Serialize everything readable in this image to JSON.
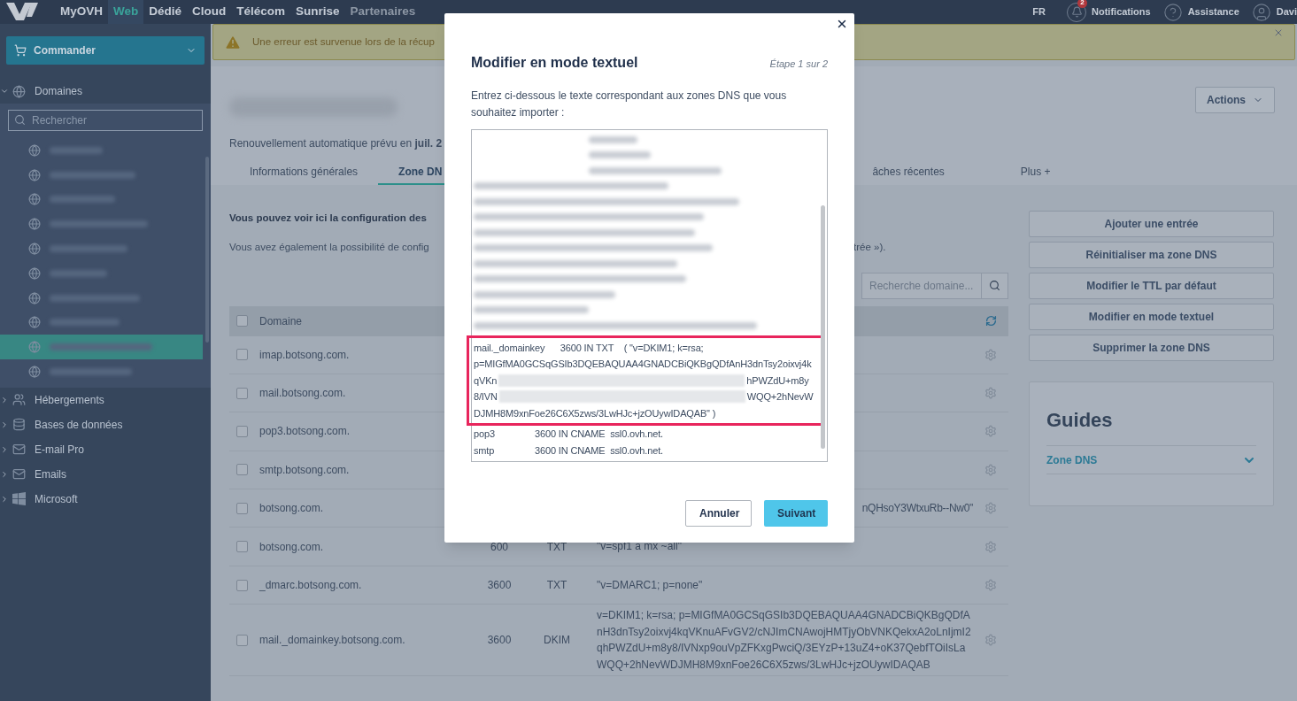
{
  "top_nav": {
    "items": [
      {
        "label": "MyOVH",
        "selected": false,
        "disabled": false
      },
      {
        "label": "Web",
        "selected": true,
        "disabled": false
      },
      {
        "label": "Dédié",
        "selected": false,
        "disabled": false
      },
      {
        "label": "Cloud",
        "selected": false,
        "disabled": false
      },
      {
        "label": "Télécom",
        "selected": false,
        "disabled": false
      },
      {
        "label": "Sunrise",
        "selected": false,
        "disabled": false
      },
      {
        "label": "Partenaires",
        "selected": false,
        "disabled": true
      }
    ],
    "language": "FR",
    "notifications": {
      "label": "Notifications",
      "badge": "2"
    },
    "assistance": "Assistance",
    "user": "Davi"
  },
  "sidebar": {
    "order_button": "Commander",
    "search_placeholder": "Rechercher",
    "sections": [
      {
        "label": "Domaines",
        "expanded": true
      },
      {
        "label": "Hébergements",
        "expanded": false
      },
      {
        "label": "Bases de données",
        "expanded": false
      },
      {
        "label": "E-mail Pro",
        "expanded": false
      },
      {
        "label": "Emails",
        "expanded": false
      },
      {
        "label": "Microsoft",
        "expanded": false
      }
    ],
    "domain_items": [
      {
        "selected": false
      },
      {
        "selected": false
      },
      {
        "selected": false
      },
      {
        "selected": false
      },
      {
        "selected": false
      },
      {
        "selected": false
      },
      {
        "selected": false
      },
      {
        "selected": false
      },
      {
        "selected": true
      },
      {
        "selected": false
      }
    ]
  },
  "alert": {
    "message": "Une erreur est survenue lors de la récup"
  },
  "header": {
    "actions_button": "Actions",
    "renewal": "Renouvellement automatique prévu en **juil. 2**",
    "tabs": [
      {
        "label": "Informations générales",
        "selected": false
      },
      {
        "label": "Zone DN",
        "selected": true
      },
      {
        "label": "âches récentes",
        "selected": false
      },
      {
        "label": "Plus +",
        "selected": false
      }
    ]
  },
  "zone": {
    "intro_bold": "Vous pouvez voir ici la configuration des",
    "intro": "Vous avez également la possibilité de config",
    "intro_end": "trée »).",
    "search_placeholder": "Recherche domaine...",
    "table": {
      "columns": [
        "Domaine"
      ],
      "header_checked": false,
      "rows": [
        {
          "domain": "imap.botsong.com.",
          "checked": false
        },
        {
          "domain": "mail.botsong.com.",
          "checked": false
        },
        {
          "domain": "pop3.botsong.com.",
          "checked": false
        },
        {
          "domain": "smtp.botsong.com.",
          "checked": false
        },
        {
          "domain": "botsong.com.",
          "target": "nQHsoY3WtxuRb--Nw0\"",
          "checked": false
        },
        {
          "domain": "botsong.com.",
          "ttl": "600",
          "type": "TXT",
          "target": "\"v=spf1 a mx ~all\"",
          "checked": false
        },
        {
          "domain": "_dmarc.botsong.com.",
          "ttl": "3600",
          "type": "TXT",
          "target": "\"v=DMARC1; p=none\"",
          "checked": false
        },
        {
          "domain": "mail._domainkey.botsong.com.",
          "ttl": "3600",
          "type": "DKIM",
          "target": "v=DKIM1; k=rsa; p=MIGfMA0GCSqGSIb3DQEBAQUAA4GNADCBiQKBgQDfAnH3dnTsy2oixvj4kqVKnuAFvGV2/cNJImCNAwojHMTjyObVNKQekxA2oLnIjmI2qhPWZdU+m8y8/IVNxp9ouVpZFKxgPwciQ/3EYzP+13uZ4+oK37QebfTOiIsLaWQQ+2hNevWDJMH8M9xnFoe26C6X5zws/3LwHJc+jzOUywIDAQAB",
          "checked": false
        }
      ]
    }
  },
  "side_actions": [
    "Ajouter une entrée",
    "Réinitialiser ma zone DNS",
    "Modifier le TTL par défaut",
    "Modifier en mode textuel",
    "Supprimer la zone DNS"
  ],
  "guides": {
    "title": "Guides",
    "items": [
      {
        "label": "Zone DNS",
        "expanded": false
      }
    ]
  },
  "modal": {
    "title": "Modifier en mode textuel",
    "step": "Étape 1 sur 2",
    "description": "Entrez ci-dessous le texte correspondant aux zones DNS que vous souhaitez importer :",
    "highlighted_lines": [
      {
        "kind": "plain",
        "text": "mail._domainkey      3600 IN TXT    ( \"v=DKIM1; k=rsa;"
      },
      {
        "kind": "plain",
        "text": "p=MIGfMA0GCSqGSIb3DQEBAQUAA4GNADCBiQKBgQDfAnH3dnTsy2oixvj4k"
      },
      {
        "kind": "redacted",
        "left": "qVKn",
        "right": "hPWZdU+m8y"
      },
      {
        "kind": "redacted",
        "left": "8/IVN",
        "right": "WQQ+2hNevW"
      },
      {
        "kind": "plain",
        "text": "DJMH8M9xnFoe26C6X5zws/3LwHJc+jzOUywIDAQAB\" )"
      }
    ],
    "records": [
      {
        "name": "pop3",
        "value": "3600 IN CNAME  ssl0.ovh.net."
      },
      {
        "name": "smtp",
        "value": "3600 IN CNAME  ssl0.ovh.net."
      }
    ],
    "buttons": [
      {
        "label": "Annuler",
        "kind": "secondary"
      },
      {
        "label": "Suivant",
        "kind": "primary"
      }
    ]
  }
}
